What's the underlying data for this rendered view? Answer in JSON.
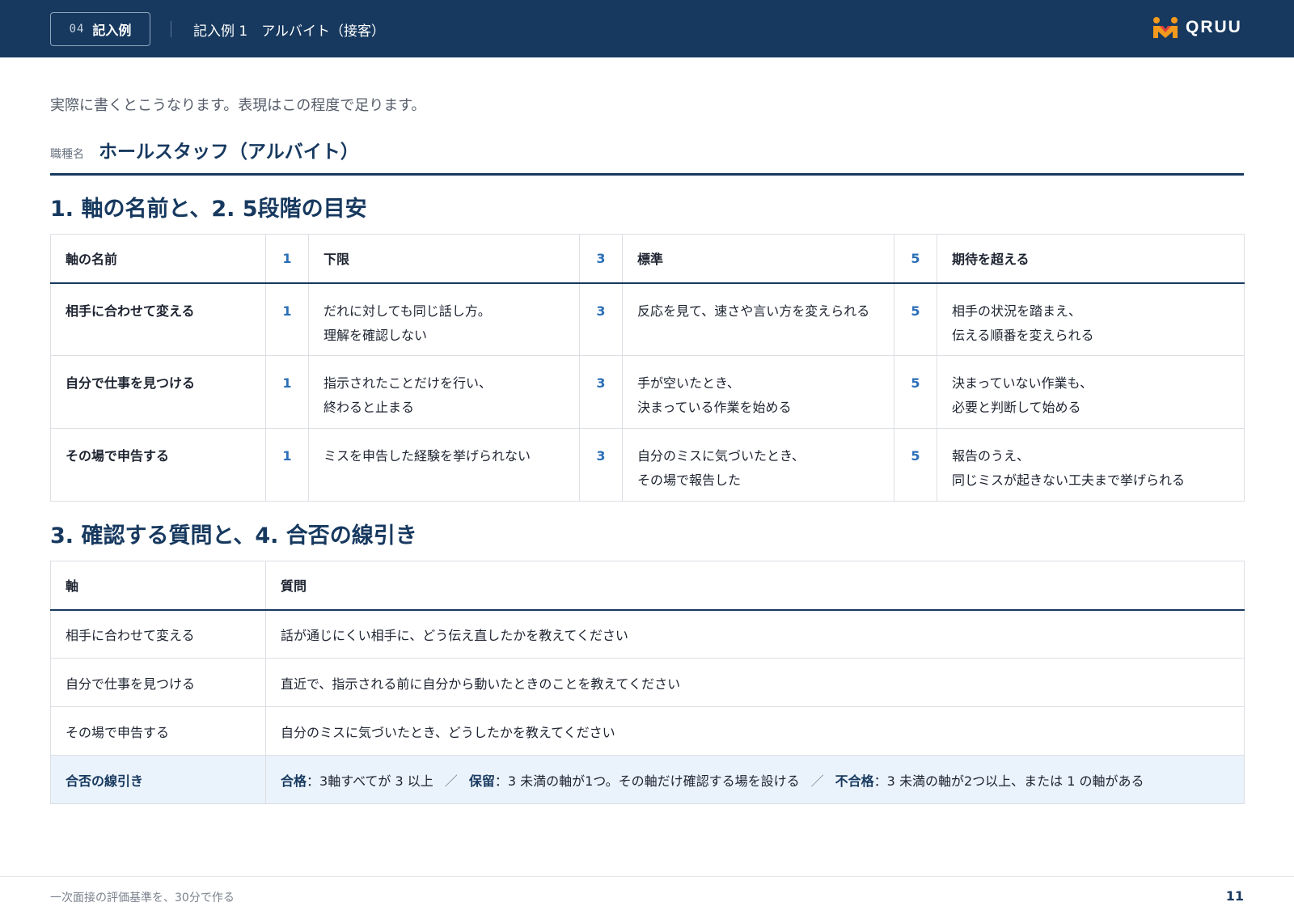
{
  "header": {
    "chapter_number": "04",
    "chapter_label": "記入例",
    "title": "記入例 1　アルバイト（接客）",
    "logo_text": "QRUU"
  },
  "intro": "実際に書くとこうなります。表現はこの程度で足ります。",
  "job": {
    "label": "職種名",
    "title": "ホールスタッフ（アルバイト）"
  },
  "section1": {
    "title": "1. 軸の名前と、2. 5段階の目安",
    "headers": {
      "axis": "軸の名前",
      "level1": "1",
      "level1_label": "下限",
      "level3": "3",
      "level3_label": "標準",
      "level5": "5",
      "level5_label": "期待を超える"
    },
    "rows": [
      {
        "axis": "相手に合わせて変える",
        "l1": "1",
        "d1": "だれに対しても同じ話し方。\n理解を確認しない",
        "l3": "3",
        "d3": "反応を見て、速さや言い方を変えられる",
        "l5": "5",
        "d5": "相手の状況を踏まえ、\n伝える順番を変えられる"
      },
      {
        "axis": "自分で仕事を見つける",
        "l1": "1",
        "d1": "指示されたことだけを行い、\n終わると止まる",
        "l3": "3",
        "d3": "手が空いたとき、\n決まっている作業を始める",
        "l5": "5",
        "d5": "決まっていない作業も、\n必要と判断して始める"
      },
      {
        "axis": "その場で申告する",
        "l1": "1",
        "d1": "ミスを申告した経験を挙げられない",
        "l3": "3",
        "d3": "自分のミスに気づいたとき、\nその場で報告した",
        "l5": "5",
        "d5": "報告のうえ、\n同じミスが起きない工夫まで挙げられる"
      }
    ]
  },
  "section2": {
    "title": "3. 確認する質問と、4. 合否の線引き",
    "headers": {
      "axis": "軸",
      "question": "質問"
    },
    "rows": [
      {
        "axis": "相手に合わせて変える",
        "question": "話が通じにくい相手に、どう伝え直したかを教えてください"
      },
      {
        "axis": "自分で仕事を見つける",
        "question": "直近で、指示される前に自分から動いたときのことを教えてください"
      },
      {
        "axis": "その場で申告する",
        "question": "自分のミスに気づいたとき、どうしたかを教えてください"
      }
    ],
    "criteria": {
      "axis": "合否の線引き",
      "pass_label": "合格",
      "pass_text": "：3軸すべてが 3 以上",
      "hold_label": "保留",
      "hold_text": "：3 未満の軸が1つ。その軸だけ確認する場を設ける",
      "fail_label": "不合格",
      "fail_text": "：3 未満の軸が2つ以上、または 1 の軸がある",
      "separator": "／"
    }
  },
  "footer": {
    "text": "一次面接の評価基準を、30分で作る",
    "page": "11"
  },
  "colors": {
    "navy": "#17395f",
    "accent_blue": "#2a6fb8",
    "logo_orange": "#f39a1e",
    "logo_red": "#e5403b",
    "highlight_row": "#eaf2fb"
  }
}
